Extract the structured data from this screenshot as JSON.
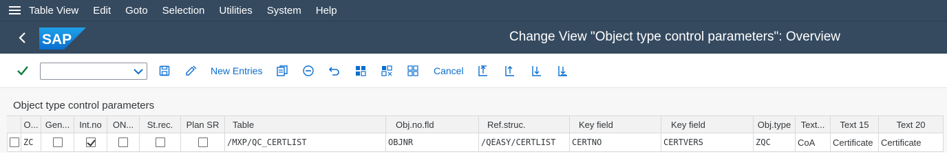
{
  "menu": {
    "items": [
      "Table View",
      "Edit",
      "Goto",
      "Selection",
      "Utilities",
      "System",
      "Help"
    ]
  },
  "header": {
    "logo_text": "SAP",
    "title": "Change View \"Object type control parameters\": Overview"
  },
  "toolbar": {
    "dropdown_value": "",
    "new_entries_label": "New Entries",
    "cancel_label": "Cancel",
    "icons": [
      "check-icon",
      "save-icon",
      "display-change-icon",
      "copy-icon",
      "delete-icon",
      "undo-icon",
      "select-all-icon",
      "select-block-icon",
      "deselect-all-icon",
      "first-page-icon",
      "previous-page-icon",
      "next-page-icon",
      "last-page-icon"
    ]
  },
  "table": {
    "title": "Object type control parameters",
    "columns": [
      "O...",
      "Gen...",
      "Int.no",
      "ON...",
      "St.rec.",
      "Plan SR",
      "Table",
      "Obj.no.fld",
      "Ref.struc.",
      "Key field",
      "Key field",
      "Obj.type",
      "Text...",
      "Text 15",
      "Text 20"
    ],
    "rows": [
      {
        "o": "ZC",
        "gen": false,
        "int_no": true,
        "on": false,
        "st_rec": false,
        "plan_sr": false,
        "table": "/MXP/QC_CERTLIST",
        "obj_no_fld": "OBJNR",
        "ref_struc": "/QEASY/CERTLIST",
        "key_field_1": "CERTNO",
        "key_field_2": "CERTVERS",
        "obj_type": "ZQC",
        "text_short": "CoA",
        "text_15": "Certificate",
        "text_20": "Certificate"
      }
    ]
  },
  "colors": {
    "shell": "#354a5f",
    "accent": "#0a6ed1",
    "ok_green": "#107e3e",
    "logo_blue": "#0a6ed1"
  }
}
